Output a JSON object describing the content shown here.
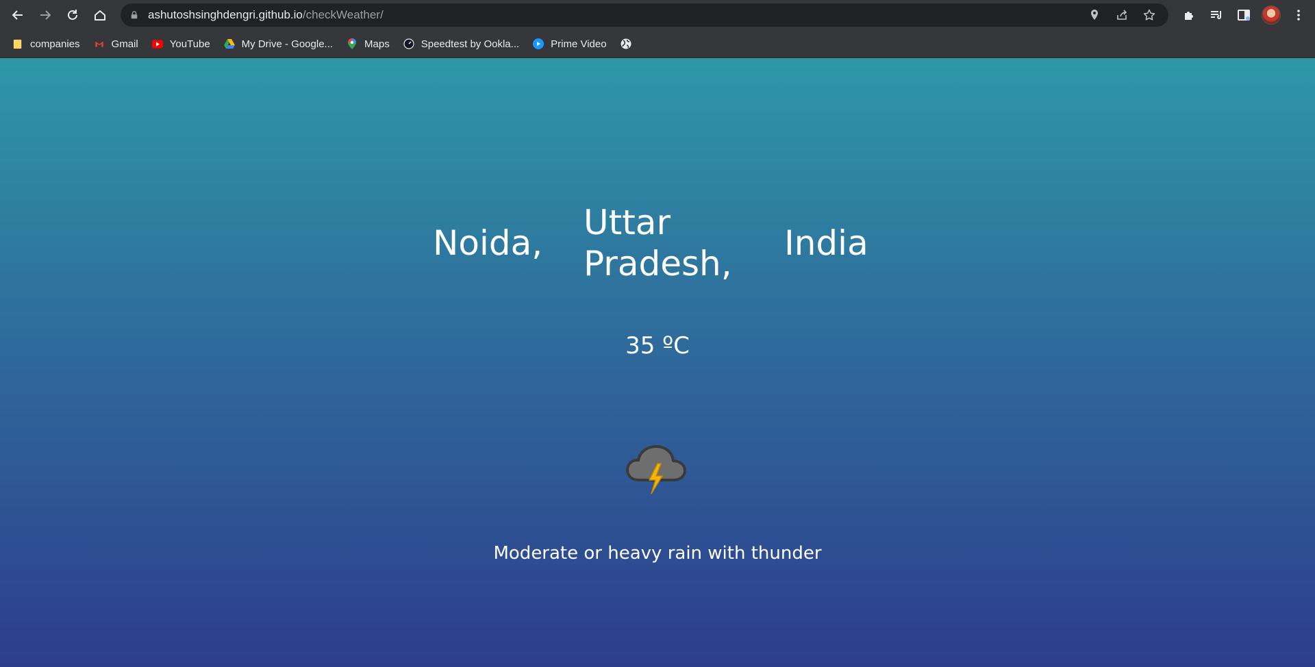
{
  "browser": {
    "url_host": "ashutoshsinghdengri.github.io",
    "url_path": "/checkWeather/"
  },
  "bookmarks": [
    {
      "label": "companies",
      "icon": "folder-icon"
    },
    {
      "label": "Gmail",
      "icon": "gmail-icon"
    },
    {
      "label": "YouTube",
      "icon": "youtube-icon"
    },
    {
      "label": "My Drive - Google...",
      "icon": "google-drive-icon"
    },
    {
      "label": "Maps",
      "icon": "maps-icon"
    },
    {
      "label": "Speedtest by Ookla...",
      "icon": "speedtest-icon"
    },
    {
      "label": "Prime Video",
      "icon": "prime-video-icon"
    },
    {
      "label": "",
      "icon": "globe-icon"
    }
  ],
  "weather": {
    "city": "Noida,",
    "state": "Uttar Pradesh,",
    "country": "India",
    "temperature": "35 ºC",
    "icon": "thunderstorm-cloud-icon",
    "condition": "Moderate or heavy rain with thunder"
  },
  "colors": {
    "gradient_top": "#2e97a7",
    "gradient_bottom": "#2d3d8d",
    "chrome": "#35363a"
  }
}
